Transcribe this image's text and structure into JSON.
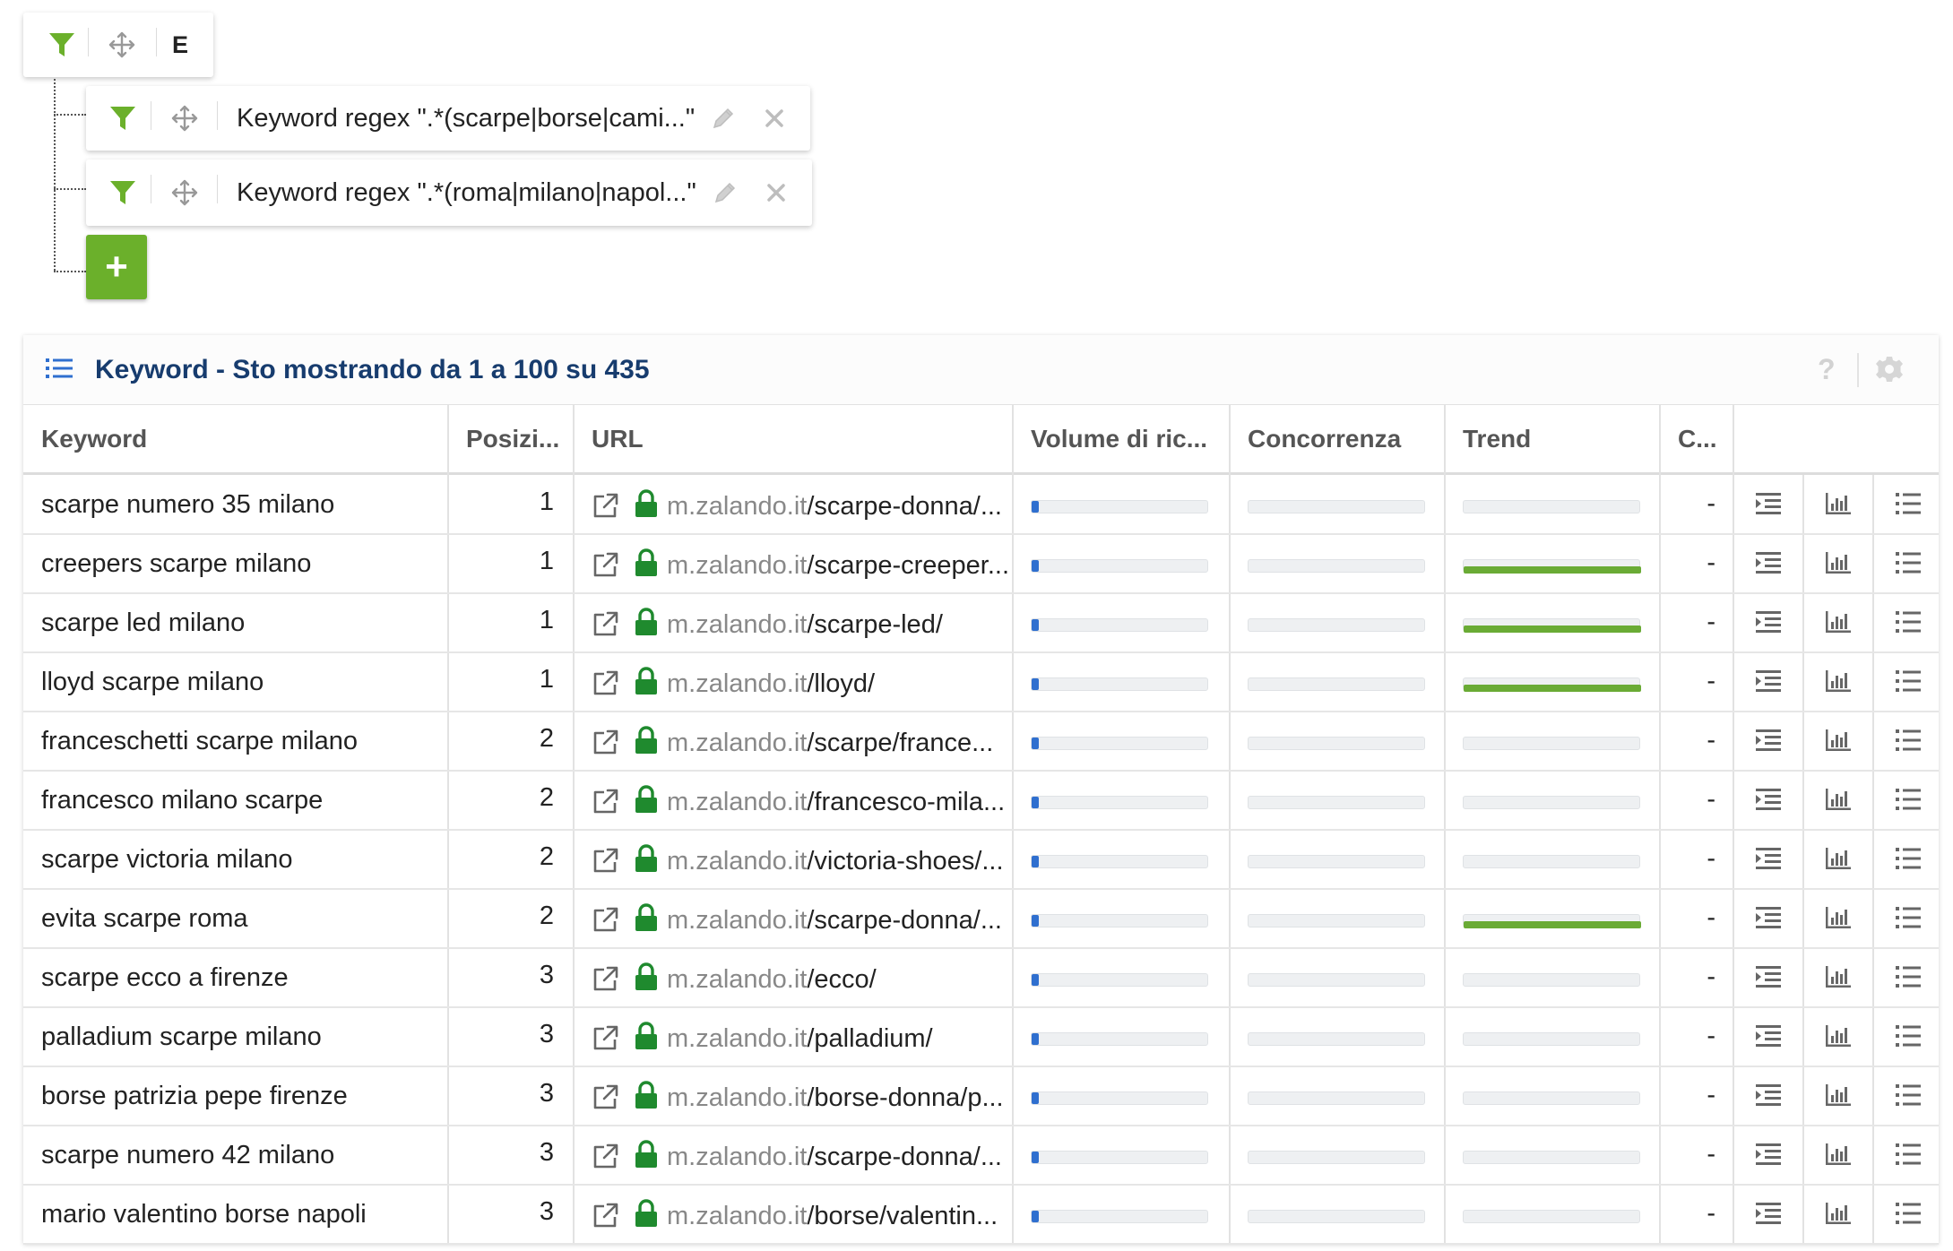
{
  "filter_root": {
    "label": "E"
  },
  "filters": [
    {
      "text": "Keyword regex \".*(scarpe|borse|cami...\""
    },
    {
      "text": "Keyword regex \".*(roma|milano|napol...\""
    }
  ],
  "add_button": {
    "label": "+"
  },
  "panel": {
    "title": "Keyword - Sto mostrando da 1 a 100 su 435",
    "help_label": "?"
  },
  "columns": {
    "keyword": "Keyword",
    "position": "Posizi...",
    "url": "URL",
    "volume": "Volume di ric...",
    "competition": "Concorrenza",
    "trend": "Trend",
    "c": "C..."
  },
  "colors": {
    "accent_green": "#6bb02b",
    "trend_green": "#6aab35",
    "volume_blue": "#2f6fcf",
    "lock_green": "#1f8a2e",
    "title_blue": "#173c6e"
  },
  "rows": [
    {
      "keyword": "scarpe numero 35 milano",
      "position": "1",
      "host": "m.zalando.it",
      "path": "/scarpe-donna/...",
      "c": "-",
      "volume": 0.04,
      "trend": 0
    },
    {
      "keyword": "creepers scarpe milano",
      "position": "1",
      "host": "m.zalando.it",
      "path": "/scarpe-creeper...",
      "c": "-",
      "volume": 0.04,
      "trend": 1
    },
    {
      "keyword": "scarpe led milano",
      "position": "1",
      "host": "m.zalando.it",
      "path": "/scarpe-led/",
      "c": "-",
      "volume": 0.04,
      "trend": 1
    },
    {
      "keyword": "lloyd scarpe milano",
      "position": "1",
      "host": "m.zalando.it",
      "path": "/lloyd/",
      "c": "-",
      "volume": 0.04,
      "trend": 1
    },
    {
      "keyword": "franceschetti scarpe milano",
      "position": "2",
      "host": "m.zalando.it",
      "path": "/scarpe/france...",
      "c": "-",
      "volume": 0.04,
      "trend": 0
    },
    {
      "keyword": "francesco milano scarpe",
      "position": "2",
      "host": "m.zalando.it",
      "path": "/francesco-mila...",
      "c": "-",
      "volume": 0.04,
      "trend": 0
    },
    {
      "keyword": "scarpe victoria milano",
      "position": "2",
      "host": "m.zalando.it",
      "path": "/victoria-shoes/...",
      "c": "-",
      "volume": 0.04,
      "trend": 0
    },
    {
      "keyword": "evita scarpe roma",
      "position": "2",
      "host": "m.zalando.it",
      "path": "/scarpe-donna/...",
      "c": "-",
      "volume": 0.04,
      "trend": 1
    },
    {
      "keyword": "scarpe ecco a firenze",
      "position": "3",
      "host": "m.zalando.it",
      "path": "/ecco/",
      "c": "-",
      "volume": 0.04,
      "trend": 0
    },
    {
      "keyword": "palladium scarpe milano",
      "position": "3",
      "host": "m.zalando.it",
      "path": "/palladium/",
      "c": "-",
      "volume": 0.04,
      "trend": 0
    },
    {
      "keyword": "borse patrizia pepe firenze",
      "position": "3",
      "host": "m.zalando.it",
      "path": "/borse-donna/p...",
      "c": "-",
      "volume": 0.04,
      "trend": 0
    },
    {
      "keyword": "scarpe numero 42 milano",
      "position": "3",
      "host": "m.zalando.it",
      "path": "/scarpe-donna/...",
      "c": "-",
      "volume": 0.04,
      "trend": 0
    },
    {
      "keyword": "mario valentino borse napoli",
      "position": "3",
      "host": "m.zalando.it",
      "path": "/borse/valentin...",
      "c": "-",
      "volume": 0.04,
      "trend": 0
    }
  ]
}
